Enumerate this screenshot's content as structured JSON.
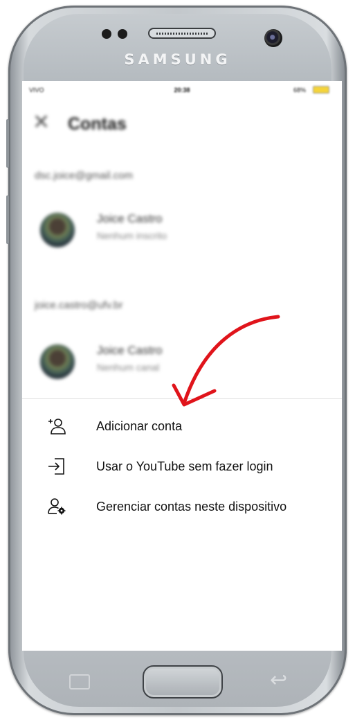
{
  "device": {
    "brand": "SAMSUNG"
  },
  "status_bar": {
    "carrier": "VIVO",
    "time": "20:38",
    "battery": "68%"
  },
  "header": {
    "close_icon": "close-icon",
    "title": "Contas"
  },
  "accounts": [
    {
      "email": "dsc.joice@gmail.com",
      "name": "Joice Castro",
      "subtitle": "Nenhum inscrito"
    },
    {
      "email": "joice.castro@ufv.br",
      "name": "Joice Castro",
      "subtitle": "Nenhum canal"
    }
  ],
  "menu": [
    {
      "label": "Adicionar conta",
      "icon": "add-account-icon"
    },
    {
      "label": "Usar o YouTube sem fazer login",
      "icon": "sign-in-arrow-icon"
    },
    {
      "label": "Gerenciar contas neste dispositivo",
      "icon": "manage-accounts-icon"
    }
  ],
  "colors": {
    "annotation_arrow": "#e0141b",
    "battery": "#f5d43a"
  }
}
